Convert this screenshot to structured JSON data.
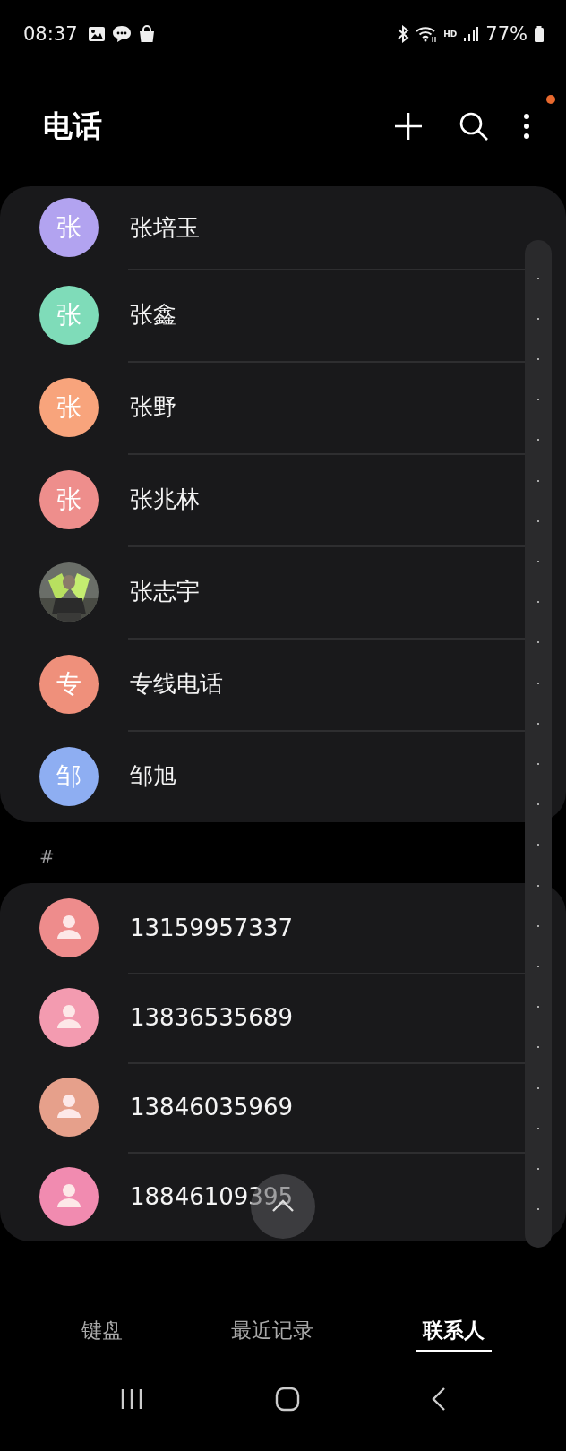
{
  "status_bar": {
    "time": "08:37",
    "network_label": "HD",
    "battery": "77%"
  },
  "header": {
    "title": "电话",
    "notification_dot": true
  },
  "groups": [
    {
      "contacts": [
        {
          "name": "张培玉",
          "avatar": {
            "kind": "initial",
            "text": "张",
            "color": "#b2a3f0"
          }
        },
        {
          "name": "张鑫",
          "avatar": {
            "kind": "initial",
            "text": "张",
            "color": "#7fdcb9"
          }
        },
        {
          "name": "张野",
          "avatar": {
            "kind": "initial",
            "text": "张",
            "color": "#f8a47c"
          }
        },
        {
          "name": "张兆林",
          "avatar": {
            "kind": "initial",
            "text": "张",
            "color": "#ee8e8c"
          }
        },
        {
          "name": "张志宇"
        },
        {
          "name": "专线电话",
          "avatar": {
            "kind": "initial",
            "text": "专",
            "color": "#ef907b"
          }
        },
        {
          "name": "邹旭",
          "avatar": {
            "kind": "initial",
            "text": "邹",
            "color": "#8eaef2"
          }
        }
      ]
    },
    {
      "header": "#",
      "contacts": [
        {
          "name": "13159957337",
          "avatar": {
            "kind": "person",
            "color": "#ee8c8c"
          }
        },
        {
          "name": "13836535689",
          "avatar": {
            "kind": "person",
            "color": "#f39bb0"
          }
        },
        {
          "name": "13846035969",
          "avatar": {
            "kind": "person",
            "color": "#e6a08b"
          }
        },
        {
          "name": "18846109395",
          "avatar": {
            "kind": "person",
            "color": "#f18bb0"
          }
        }
      ]
    }
  ],
  "bottom_tabs": [
    {
      "label": "键盘",
      "selected": false
    },
    {
      "label": "最近记录",
      "selected": false
    },
    {
      "label": "联系人",
      "selected": true
    }
  ]
}
